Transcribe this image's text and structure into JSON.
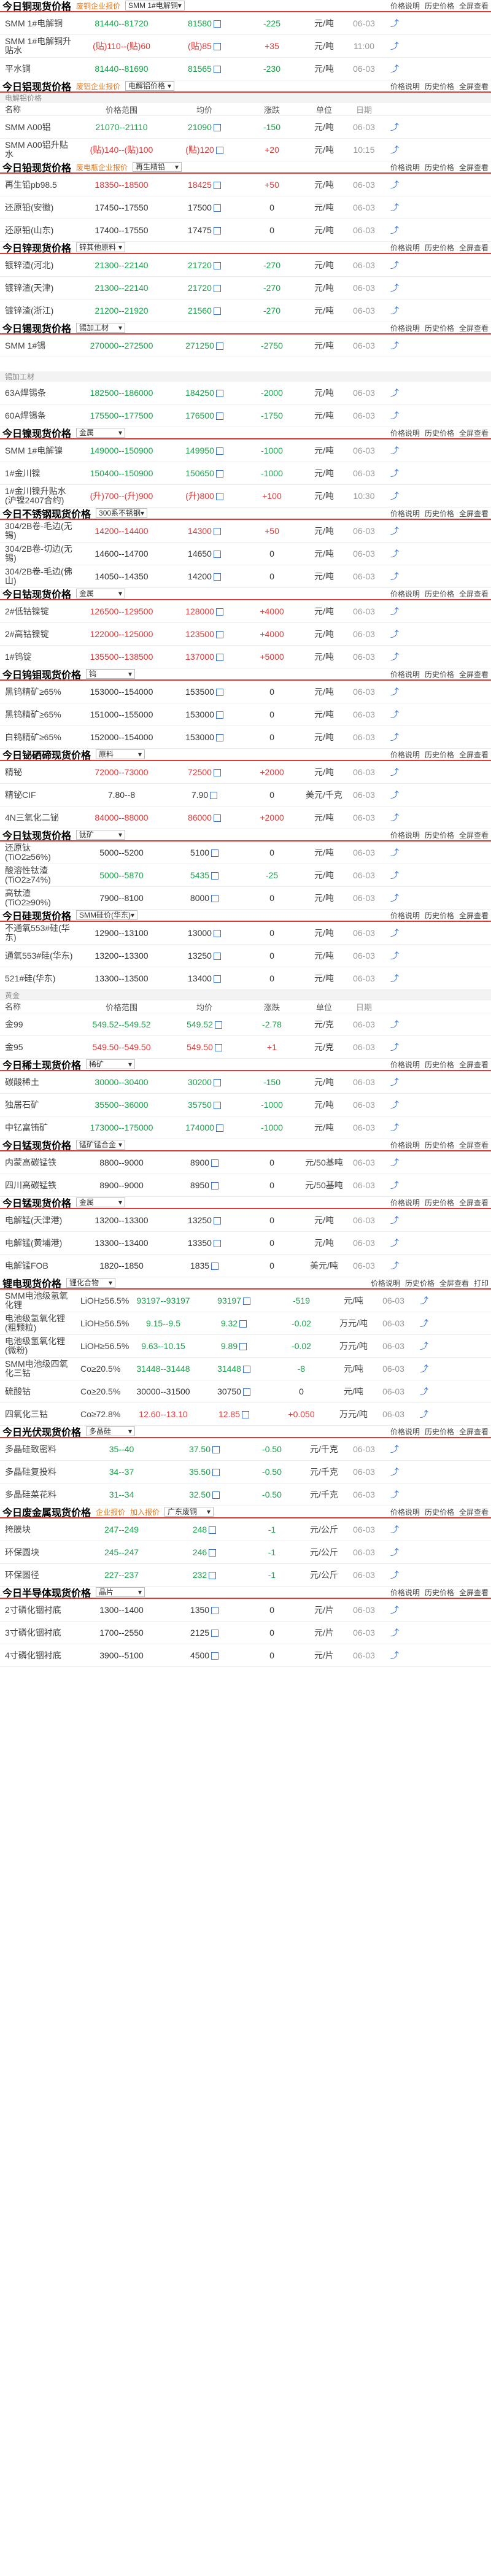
{
  "links": {
    "explain": "价格说明",
    "history": "历史价格",
    "fullscreen": "全屏查看"
  },
  "copper": {
    "title": "今日铜现货价格",
    "tag": "废铜企业报价",
    "select": "SMM 1#电解铜",
    "rows": [
      {
        "name": "SMM 1#电解铜",
        "range": "81440--81720",
        "avg": "81580",
        "chg": "-225",
        "unit": "元/吨",
        "date": "06-03",
        "dir": "down"
      },
      {
        "name": "SMM 1#电解铜升贴水",
        "range": "(贴)110--(贴)60",
        "avg": "(贴)85",
        "chg": "+35",
        "unit": "元/吨",
        "date": "11:00",
        "dir": "up"
      },
      {
        "name": "平水铜",
        "range": "81440--81690",
        "avg": "81565",
        "chg": "-230",
        "unit": "元/吨",
        "date": "06-03",
        "dir": "down"
      }
    ]
  },
  "aluminum": {
    "title": "今日铝现货价格",
    "tag": "废铝企业报价",
    "select": "电解铝价格",
    "group": "电解铝价格",
    "hdr": {
      "name": "名称",
      "range": "价格范围",
      "avg": "均价",
      "chg": "涨跌",
      "unit": "单位",
      "date": "日期"
    },
    "rows": [
      {
        "name": "SMM A00铝",
        "range": "21070--21110",
        "avg": "21090",
        "chg": "-150",
        "unit": "元/吨",
        "date": "06-03",
        "dir": "down"
      },
      {
        "name": "SMM A00铝升贴水",
        "range": "(贴)140--(贴)100",
        "avg": "(贴)120",
        "chg": "+20",
        "unit": "元/吨",
        "date": "10:15",
        "dir": "up"
      }
    ]
  },
  "lead": {
    "title": "今日铅现货价格",
    "tag": "废电瓶企业报价",
    "select": "再生精铅",
    "rows": [
      {
        "name": "再生铅pb98.5",
        "range": "18350--18500",
        "avg": "18425",
        "chg": "+50",
        "unit": "元/吨",
        "date": "06-03",
        "dir": "up"
      },
      {
        "name": "还原铅(安徽)",
        "range": "17450--17550",
        "avg": "17500",
        "chg": "0",
        "unit": "元/吨",
        "date": "06-03",
        "dir": "flat"
      },
      {
        "name": "还原铅(山东)",
        "range": "17400--17550",
        "avg": "17475",
        "chg": "0",
        "unit": "元/吨",
        "date": "06-03",
        "dir": "flat"
      }
    ]
  },
  "zinc": {
    "title": "今日锌现货价格",
    "select": "锌其他原料",
    "rows": [
      {
        "name": "镀锌渣(河北)",
        "range": "21300--22140",
        "avg": "21720",
        "chg": "-270",
        "unit": "元/吨",
        "date": "06-03",
        "dir": "down"
      },
      {
        "name": "镀锌渣(天津)",
        "range": "21300--22140",
        "avg": "21720",
        "chg": "-270",
        "unit": "元/吨",
        "date": "06-03",
        "dir": "down"
      },
      {
        "name": "镀锌渣(浙江)",
        "range": "21200--21920",
        "avg": "21560",
        "chg": "-270",
        "unit": "元/吨",
        "date": "06-03",
        "dir": "down"
      }
    ]
  },
  "tin": {
    "title": "今日锡现货价格",
    "select": "锡加工材",
    "rows": [
      {
        "name": "SMM 1#锡",
        "range": "270000--272500",
        "avg": "271250",
        "chg": "-2750",
        "unit": "元/吨",
        "date": "06-03",
        "dir": "down"
      }
    ],
    "group": "锡加工材",
    "rows2": [
      {
        "name": "63A焊锡条",
        "range": "182500--186000",
        "avg": "184250",
        "chg": "-2000",
        "unit": "元/吨",
        "date": "06-03",
        "dir": "down"
      },
      {
        "name": "60A焊锡条",
        "range": "175500--177500",
        "avg": "176500",
        "chg": "-1750",
        "unit": "元/吨",
        "date": "06-03",
        "dir": "down"
      }
    ]
  },
  "nickel": {
    "title": "今日镍现货价格",
    "select": "金属",
    "rows": [
      {
        "name": "SMM 1#电解镍",
        "range": "149000--150900",
        "avg": "149950",
        "chg": "-1000",
        "unit": "元/吨",
        "date": "06-03",
        "dir": "down"
      },
      {
        "name": "1#金川镍",
        "range": "150400--150900",
        "avg": "150650",
        "chg": "-1000",
        "unit": "元/吨",
        "date": "06-03",
        "dir": "down"
      },
      {
        "name": "1#金川镍升贴水(沪镍2407合约)",
        "range": "(升)700--(升)900",
        "avg": "(升)800",
        "chg": "+100",
        "unit": "元/吨",
        "date": "10:30",
        "dir": "up"
      }
    ]
  },
  "stainless": {
    "title": "今日不锈钢现货价格",
    "select": "300系不锈钢",
    "rows": [
      {
        "name": "304/2B卷-毛边(无锡)",
        "range": "14200--14400",
        "avg": "14300",
        "chg": "+50",
        "unit": "元/吨",
        "date": "06-03",
        "dir": "up"
      },
      {
        "name": "304/2B卷-切边(无锡)",
        "range": "14600--14700",
        "avg": "14650",
        "chg": "0",
        "unit": "元/吨",
        "date": "06-03",
        "dir": "flat"
      },
      {
        "name": "304/2B卷-毛边(佛山)",
        "range": "14050--14350",
        "avg": "14200",
        "chg": "0",
        "unit": "元/吨",
        "date": "06-03",
        "dir": "flat"
      }
    ]
  },
  "cobalt": {
    "title": "今日钴现货价格",
    "select": "金属",
    "rows": [
      {
        "name": "2#低钴镍锭",
        "range": "126500--129500",
        "avg": "128000",
        "chg": "+4000",
        "unit": "元/吨",
        "date": "06-03",
        "dir": "up"
      },
      {
        "name": "2#高钴镍锭",
        "range": "122000--125000",
        "avg": "123500",
        "chg": "+4000",
        "unit": "元/吨",
        "date": "06-03",
        "dir": "up"
      },
      {
        "name": "1#钨锭",
        "range": "135500--138500",
        "avg": "137000",
        "chg": "+5000",
        "unit": "元/吨",
        "date": "06-03",
        "dir": "up"
      }
    ]
  },
  "molybdenum": {
    "title": "今日钨钼现货价格",
    "select": "钨",
    "rows": [
      {
        "name": "黑钨精矿≥65%",
        "range": "153000--154000",
        "avg": "153500",
        "chg": "0",
        "unit": "元/吨",
        "date": "06-03",
        "dir": "flat"
      },
      {
        "name": "黑钨精矿≥65%",
        "range": "151000--155000",
        "avg": "153000",
        "chg": "0",
        "unit": "元/吨",
        "date": "06-03",
        "dir": "flat"
      },
      {
        "name": "白钨精矿≥65%",
        "range": "152000--154000",
        "avg": "153000",
        "chg": "0",
        "unit": "元/吨",
        "date": "06-03",
        "dir": "flat"
      }
    ]
  },
  "antimony": {
    "title": "今日铋硒碲现货价格",
    "select": "原料",
    "rows": [
      {
        "name": "精铋",
        "range": "72000--73000",
        "avg": "72500",
        "chg": "+2000",
        "unit": "元/吨",
        "date": "06-03",
        "dir": "up"
      },
      {
        "name": "精铋CIF",
        "range": "7.80--8",
        "avg": "7.90",
        "chg": "0",
        "unit": "美元/千克",
        "date": "06-03",
        "dir": "flat"
      },
      {
        "name": "4N三氧化二铋",
        "range": "84000--88000",
        "avg": "86000",
        "chg": "+2000",
        "unit": "元/吨",
        "date": "06-03",
        "dir": "up"
      }
    ]
  },
  "titanium": {
    "title": "今日钛现货价格",
    "select": "钛矿",
    "rows": [
      {
        "name": "还原钛(TiO2≥56%)",
        "range": "5000--5200",
        "avg": "5100",
        "chg": "0",
        "unit": "元/吨",
        "date": "06-03",
        "dir": "flat"
      },
      {
        "name": "酸溶性钛渣(TiO2≥74%)",
        "range": "5000--5870",
        "avg": "5435",
        "chg": "-25",
        "unit": "元/吨",
        "date": "06-03",
        "dir": "down"
      },
      {
        "name": "高钛渣(TiO2≥90%)",
        "range": "7900--8100",
        "avg": "8000",
        "chg": "0",
        "unit": "元/吨",
        "date": "06-03",
        "dir": "flat"
      }
    ]
  },
  "silicon": {
    "title": "今日硅现货价格",
    "select": "SMM硅价(华东)",
    "rows": [
      {
        "name": "不通氧553#硅(华东)",
        "range": "12900--13100",
        "avg": "13000",
        "chg": "0",
        "unit": "元/吨",
        "date": "06-03",
        "dir": "flat"
      },
      {
        "name": "通氧553#硅(华东)",
        "range": "13200--13300",
        "avg": "13250",
        "chg": "0",
        "unit": "元/吨",
        "date": "06-03",
        "dir": "flat"
      },
      {
        "name": "521#硅(华东)",
        "range": "13300--13500",
        "avg": "13400",
        "chg": "0",
        "unit": "元/吨",
        "date": "06-03",
        "dir": "flat"
      }
    ]
  },
  "gold": {
    "group": "黄金",
    "hdr": {
      "name": "名称",
      "range": "价格范围",
      "avg": "均价",
      "chg": "涨跌",
      "unit": "单位",
      "date": "日期"
    },
    "rows": [
      {
        "name": "金99",
        "range": "549.52--549.52",
        "avg": "549.52",
        "chg": "-2.78",
        "unit": "元/克",
        "date": "06-03",
        "dir": "down"
      },
      {
        "name": "金95",
        "range": "549.50--549.50",
        "avg": "549.50",
        "chg": "+1",
        "unit": "元/克",
        "date": "06-03",
        "dir": "up"
      }
    ]
  },
  "rare": {
    "title": "今日稀土现货价格",
    "select": "稀矿",
    "rows": [
      {
        "name": "碳酸稀土",
        "range": "30000--30400",
        "avg": "30200",
        "chg": "-150",
        "unit": "元/吨",
        "date": "06-03",
        "dir": "down"
      },
      {
        "name": "独居石矿",
        "range": "35500--36000",
        "avg": "35750",
        "chg": "-1000",
        "unit": "元/吨",
        "date": "06-03",
        "dir": "down"
      },
      {
        "name": "中钇富铕矿",
        "range": "173000--175000",
        "avg": "174000",
        "chg": "-1000",
        "unit": "元/吨",
        "date": "06-03",
        "dir": "down"
      }
    ]
  },
  "manganese": {
    "title": "今日锰现货价格",
    "select": "锰矿锰合金",
    "rows": [
      {
        "name": "内蒙高碳锰铁",
        "range": "8800--9000",
        "avg": "8900",
        "chg": "0",
        "unit": "元/50基吨",
        "date": "06-03",
        "dir": "flat"
      },
      {
        "name": "四川高碳锰铁",
        "range": "8900--9000",
        "avg": "8950",
        "chg": "0",
        "unit": "元/50基吨",
        "date": "06-03",
        "dir": "flat"
      }
    ]
  },
  "manganese2": {
    "title": "今日锰现货价格",
    "select": "金属",
    "rows": [
      {
        "name": "电解锰(天津港)",
        "range": "13200--13300",
        "avg": "13250",
        "chg": "0",
        "unit": "元/吨",
        "date": "06-03",
        "dir": "flat"
      },
      {
        "name": "电解锰(黄埔港)",
        "range": "13300--13400",
        "avg": "13350",
        "chg": "0",
        "unit": "元/吨",
        "date": "06-03",
        "dir": "flat"
      },
      {
        "name": "电解锰FOB",
        "range": "1820--1850",
        "avg": "1835",
        "chg": "0",
        "unit": "美元/吨",
        "date": "06-03",
        "dir": "flat"
      }
    ]
  },
  "lithium": {
    "title": "锂电现货价格",
    "select": "锂化合物",
    "print": "打印",
    "rows": [
      {
        "name": "SMM电池级氢氧化锂",
        "spec": "LiOH≥56.5%",
        "range": "93197--93197",
        "avg": "93197",
        "chg": "-519",
        "unit": "元/吨",
        "date": "06-03",
        "dir": "down"
      },
      {
        "name": "电池级氢氧化锂(粗颗粒)",
        "spec": "LiOH≥56.5%",
        "range": "9.15--9.5",
        "avg": "9.32",
        "chg": "-0.02",
        "unit": "万元/吨",
        "date": "06-03",
        "dir": "down"
      },
      {
        "name": "电池级氢氧化锂(微粉)",
        "spec": "LiOH≥56.5%",
        "range": "9.63--10.15",
        "avg": "9.89",
        "chg": "-0.02",
        "unit": "万元/吨",
        "date": "06-03",
        "dir": "down"
      },
      {
        "name": "SMM电池级四氧化三钴",
        "spec": "Co≥20.5%",
        "range": "31448--31448",
        "avg": "31448",
        "chg": "-8",
        "unit": "元/吨",
        "date": "06-03",
        "dir": "down"
      },
      {
        "name": "硫酸钴",
        "spec": "Co≥20.5%",
        "range": "30000--31500",
        "avg": "30750",
        "chg": "0",
        "unit": "元/吨",
        "date": "06-03",
        "dir": "flat"
      },
      {
        "name": "四氧化三钴",
        "spec": "Co≥72.8%",
        "range": "12.60--13.10",
        "avg": "12.85",
        "chg": "+0.050",
        "unit": "万元/吨",
        "date": "06-03",
        "dir": "up"
      }
    ]
  },
  "pv": {
    "title": "今日光伏现货价格",
    "select": "多晶硅",
    "rows": [
      {
        "name": "多晶硅致密料",
        "range": "35--40",
        "avg": "37.50",
        "chg": "-0.50",
        "unit": "元/千克",
        "date": "06-03",
        "dir": "down"
      },
      {
        "name": "多晶硅复投料",
        "range": "34--37",
        "avg": "35.50",
        "chg": "-0.50",
        "unit": "元/千克",
        "date": "06-03",
        "dir": "down"
      },
      {
        "name": "多晶硅菜花料",
        "range": "31--34",
        "avg": "32.50",
        "chg": "-0.50",
        "unit": "元/千克",
        "date": "06-03",
        "dir": "down"
      }
    ]
  },
  "scrap": {
    "title": "今日废金属现货价格",
    "tag": "企业报价",
    "tag2": "加入报价",
    "select": "广东废铜",
    "rows": [
      {
        "name": "挎膜块",
        "range": "247--249",
        "avg": "248",
        "chg": "-1",
        "unit": "元/公斤",
        "date": "06-03",
        "dir": "down"
      },
      {
        "name": "环保圆块",
        "range": "245--247",
        "avg": "246",
        "chg": "-1",
        "unit": "元/公斤",
        "date": "06-03",
        "dir": "down"
      },
      {
        "name": "环保圆径",
        "range": "227--237",
        "avg": "232",
        "chg": "-1",
        "unit": "元/公斤",
        "date": "06-03",
        "dir": "down"
      }
    ]
  },
  "semi": {
    "title": "今日半导体现货价格",
    "select": "晶片",
    "rows": [
      {
        "name": "2寸磷化铟衬底",
        "range": "1300--1400",
        "avg": "1350",
        "chg": "0",
        "unit": "元/片",
        "date": "06-03",
        "dir": "flat"
      },
      {
        "name": "3寸磷化铟衬底",
        "range": "1700--2550",
        "avg": "2125",
        "chg": "0",
        "unit": "元/片",
        "date": "06-03",
        "dir": "flat"
      },
      {
        "name": "4寸磷化铟衬底",
        "range": "3900--5100",
        "avg": "4500",
        "chg": "0",
        "unit": "元/片",
        "date": "06-03",
        "dir": "flat"
      }
    ]
  }
}
